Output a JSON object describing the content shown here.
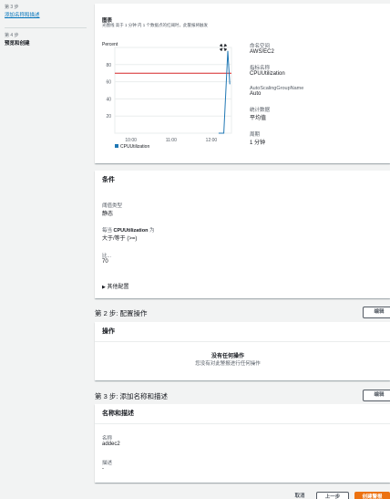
{
  "sidebar": {
    "step3_label": "第 3 步",
    "step3_link": "添加名称和描述",
    "step4_label": "第 4 步",
    "step4_current": "预览和创建"
  },
  "graph": {
    "title": "图表",
    "subtitle": "光圈线 高于 1 分钟 内 1 个数据点的红阈时，此警报将触发",
    "expand_icon": "expand-arrows-icon",
    "ylabel": "Percent",
    "legend": "CPUUtilization"
  },
  "metric": {
    "namespace_label": "命名空间",
    "namespace_value": "AWS/EC2",
    "metric_name_label": "指标名称",
    "metric_name_value": "CPUUtilization",
    "asg_label": "AutoScalingGroupName",
    "asg_value": "Auto",
    "statistic_label": "统计数据",
    "statistic_value": "平均值",
    "period_label": "周期",
    "period_value": "1 分钟"
  },
  "conditions": {
    "header": "条件",
    "threshold_type_label": "阈值类型",
    "threshold_type_value": "静态",
    "whenever_prefix": "每当",
    "whenever_metric": "CPUUtilization",
    "whenever_suffix": "为",
    "operator_value": "大于/等于 (>=)",
    "than_label": "比...",
    "than_value": "70",
    "additional_config": "其他配置"
  },
  "step2": {
    "title": "第 2 步: 配置操作",
    "edit": "编辑",
    "panel_header": "操作",
    "empty_title": "没有任何操作",
    "empty_desc": "您没有对此警报进行任何操作"
  },
  "step3": {
    "title": "第 3 步: 添加名称和描述",
    "edit": "编辑",
    "panel_header": "名称和描述",
    "name_label": "名称",
    "name_value": "addec2",
    "desc_label": "描述",
    "desc_value": "-"
  },
  "footer": {
    "cancel": "取消",
    "previous": "上一步",
    "create": "创建警报"
  },
  "chart_data": {
    "type": "line",
    "ylabel": "Percent",
    "yticks": [
      20,
      40,
      60,
      80
    ],
    "xticks": [
      "10:00",
      "11:00",
      "12:00"
    ],
    "series": [
      {
        "name": "CPUUtilization",
        "color": "#1f77b4",
        "points": [
          [
            0,
            0
          ],
          [
            12.9,
            0
          ],
          [
            13.2,
            0
          ],
          [
            13.3,
            0
          ],
          [
            13.55,
            0
          ],
          [
            14.05,
            96
          ],
          [
            14.3,
            57
          ]
        ]
      }
    ],
    "threshold": {
      "value": 70,
      "color": "#d62728"
    },
    "x_range": [
      0,
      14.5
    ],
    "y_range": [
      0,
      100
    ]
  }
}
